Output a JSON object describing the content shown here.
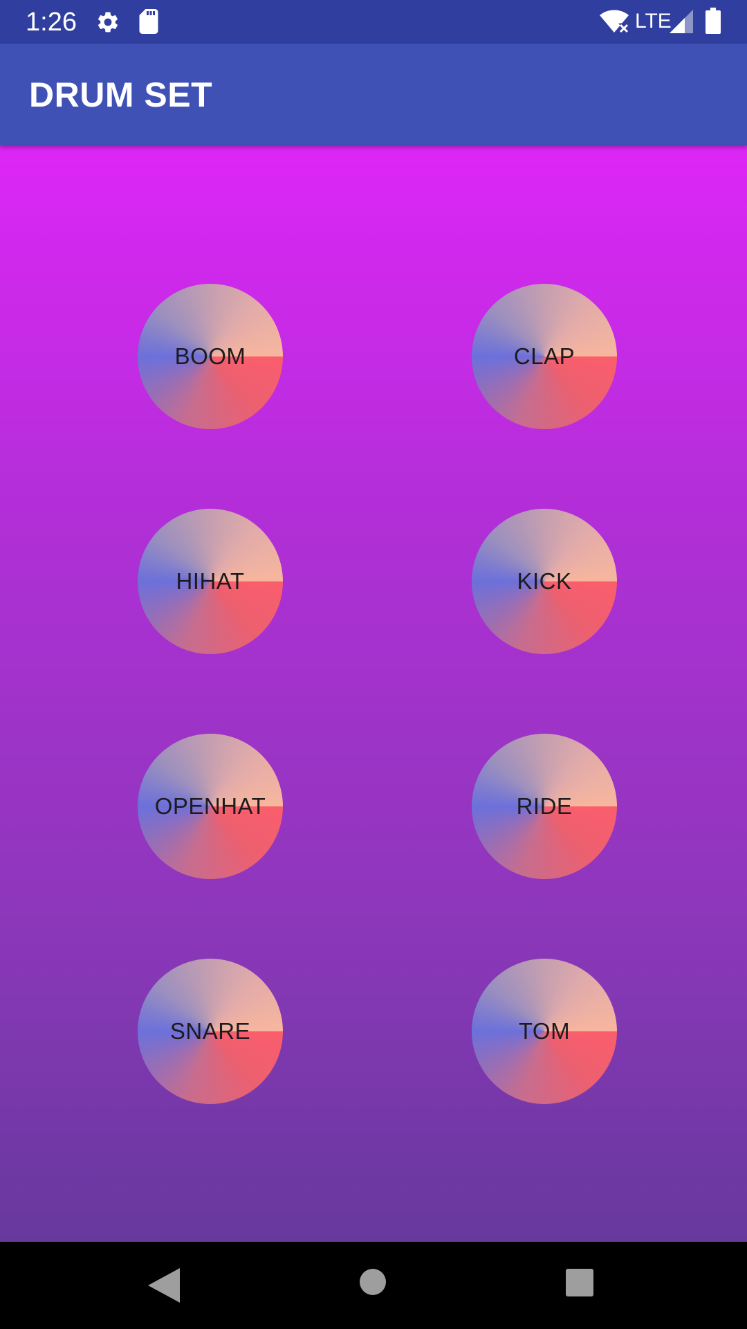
{
  "status_bar": {
    "time": "1:26",
    "network": "LTE",
    "icons": [
      "gear-icon",
      "sd-card-icon",
      "wifi-icon",
      "signal-icon",
      "battery-icon"
    ]
  },
  "app_bar": {
    "title": "DRUM SET",
    "color": "#3f51b5"
  },
  "pads": [
    {
      "label": "BOOM"
    },
    {
      "label": "CLAP"
    },
    {
      "label": "HIHAT"
    },
    {
      "label": "KICK"
    },
    {
      "label": "OPENHAT"
    },
    {
      "label": "RIDE"
    },
    {
      "label": "SNARE"
    },
    {
      "label": "TOM"
    }
  ],
  "navigation": {
    "icons": [
      "back-icon",
      "home-icon",
      "recents-icon"
    ]
  },
  "colors": {
    "status_bar": "#303f9f",
    "background_top": "#dd26f6",
    "background_bottom": "#67399d"
  }
}
